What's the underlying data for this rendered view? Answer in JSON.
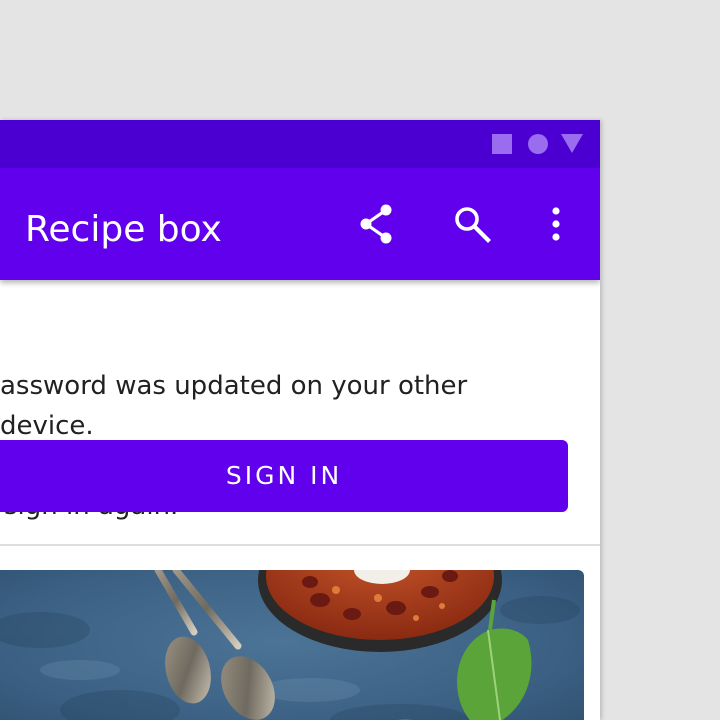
{
  "app_bar": {
    "title": "Recipe box",
    "actions": [
      "share-icon",
      "search-icon",
      "more-vert-icon"
    ]
  },
  "status_bar": {
    "icons": [
      "square-icon",
      "circle-icon",
      "triangle-icon"
    ]
  },
  "banner": {
    "message_line1": "assword was updated on your other device.",
    "message_line2": "sign in again.",
    "button_label": "SIGN IN"
  },
  "colors": {
    "primary": "#6100ed",
    "primary_dark": "#4b00d1",
    "background": "#e4e4e4",
    "surface": "#ffffff",
    "text": "#212121"
  },
  "content": {
    "image": "recipe-photo chili bowl with spoons and spinach"
  }
}
